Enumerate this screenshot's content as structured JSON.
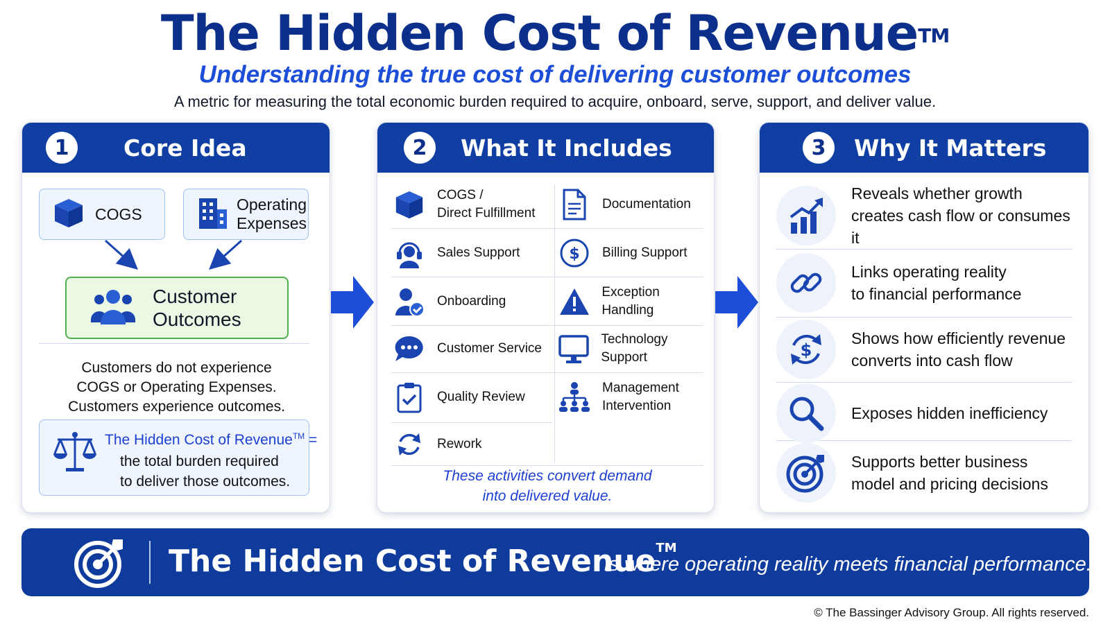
{
  "header": {
    "title": "The Hidden Cost of Revenue",
    "title_mark": "TM",
    "subtitle": "Understanding the true cost of delivering customer outcomes",
    "description": "A metric for measuring the total economic burden required to acquire, onboard, serve, support, and deliver value."
  },
  "panels": {
    "core": {
      "number": "1",
      "title": "Core Idea",
      "inputs": [
        {
          "label": "COGS",
          "icon": "box-icon"
        },
        {
          "label_line1": "Operating",
          "label_line2": "Expenses",
          "icon": "building-icon"
        }
      ],
      "outcome_line1": "Customer",
      "outcome_line2": "Outcomes",
      "outcome_icon": "people-icon",
      "statement_line1": "Customers do not experience",
      "statement_line2": "COGS or Operating Expenses.",
      "statement_line3": "Customers experience outcomes.",
      "formula_title": "The Hidden Cost of Revenue",
      "formula_mark": "TM",
      "formula_eq": " =",
      "formula_line1": "the total burden required",
      "formula_line2": "to deliver those outcomes.",
      "formula_icon": "scales-icon"
    },
    "includes": {
      "number": "2",
      "title": "What It Includes",
      "left_items": [
        {
          "label_line1": "COGS /",
          "label_line2": "Direct Fulfillment",
          "icon": "box-icon"
        },
        {
          "label_line1": "Sales Support",
          "icon": "headset-icon"
        },
        {
          "label_line1": "Onboarding",
          "icon": "user-check-icon"
        },
        {
          "label_line1": "Customer Service",
          "icon": "chat-icon"
        },
        {
          "label_line1": "Quality Review",
          "icon": "clipboard-check-icon"
        },
        {
          "label_line1": "Rework",
          "icon": "refresh-icon"
        }
      ],
      "right_items": [
        {
          "label_line1": "Documentation",
          "icon": "document-icon"
        },
        {
          "label_line1": "Billing Support",
          "icon": "dollar-circle-icon"
        },
        {
          "label_line1": "Exception Handling",
          "icon": "warning-icon"
        },
        {
          "label_line1": "Technology Support",
          "icon": "monitor-icon"
        },
        {
          "label_line1": "Management",
          "label_line2": "Intervention",
          "icon": "org-chart-icon"
        }
      ],
      "note_line1": "These activities convert demand",
      "note_line2": "into delivered value."
    },
    "why": {
      "number": "3",
      "title": "Why It Matters",
      "items": [
        {
          "line1": "Reveals whether growth",
          "line2": "creates cash flow or consumes it",
          "icon": "growth-chart-icon"
        },
        {
          "line1": "Links operating reality",
          "line2": "to financial performance",
          "icon": "link-icon"
        },
        {
          "line1": "Shows how efficiently revenue",
          "line2": "converts into cash flow",
          "icon": "dollar-cycle-icon"
        },
        {
          "line1": "Exposes hidden inefficiency",
          "line2": "",
          "icon": "magnifier-icon"
        },
        {
          "line1": "Supports better business",
          "line2": "model and pricing decisions",
          "icon": "target-icon"
        }
      ]
    }
  },
  "banner": {
    "title": "The Hidden Cost of Revenue",
    "title_mark": "TM",
    "tagline": "is where operating reality meets financial performance.",
    "icon": "target-icon"
  },
  "footer": {
    "copyright": "© The Bassinger Advisory Group. All rights reserved."
  },
  "colors": {
    "navy": "#0b2f8a",
    "header_blue": "#103ea3",
    "accent_blue": "#1d4ed8",
    "light_blue_fill": "#eef5ff",
    "green_border": "#4fb04f",
    "green_fill": "#eaf8e4"
  }
}
